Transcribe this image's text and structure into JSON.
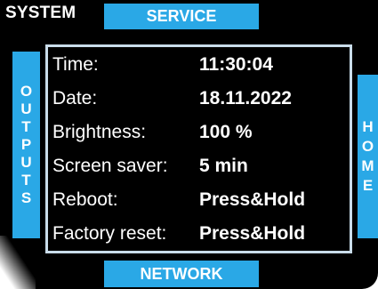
{
  "header": {
    "title": "SYSTEM"
  },
  "nav": {
    "top": "SERVICE",
    "bottom": "NETWORK",
    "left": [
      "O",
      "U",
      "T",
      "P",
      "U",
      "T",
      "S"
    ],
    "right": [
      "H",
      "O",
      "M",
      "E"
    ]
  },
  "settings": [
    {
      "label": "Time:",
      "value": "11:30:04"
    },
    {
      "label": "Date:",
      "value": "18.11.2022"
    },
    {
      "label": "Brightness:",
      "value": "100 %"
    },
    {
      "label": "Screen saver:",
      "value": "5 min"
    },
    {
      "label": "Reboot:",
      "value": "Press&Hold"
    },
    {
      "label": "Factory reset:",
      "value": "Press&Hold"
    }
  ],
  "colors": {
    "accent": "#2aa8e6",
    "background": "#000000",
    "frame": "#c9dcea",
    "text": "#ffffff"
  }
}
